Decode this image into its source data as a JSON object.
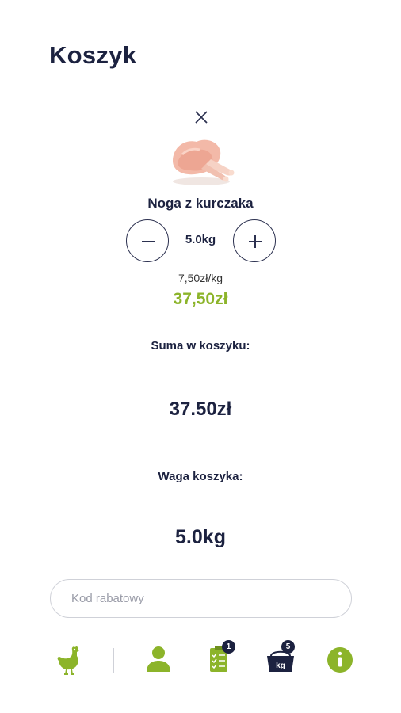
{
  "header": {
    "title": "Koszyk"
  },
  "cart_item": {
    "name": "Noga z kurczaka",
    "quantity": "5.0kg",
    "unit_price": "7,50zł/kg",
    "total": "37,50zł",
    "image": "chicken-leg"
  },
  "summary": {
    "sum_label": "Suma w koszyku:",
    "sum_value": "37.50zł",
    "weight_label": "Waga koszyka:",
    "weight_value": "5.0kg"
  },
  "coupon": {
    "placeholder": "Kod rabatowy"
  },
  "bottom_nav": {
    "items": [
      {
        "icon": "chicken-icon"
      },
      {
        "icon": "user-icon"
      },
      {
        "icon": "clipboard-icon",
        "badge": "1"
      },
      {
        "icon": "basket-kg-icon",
        "badge": "5",
        "label": "kg"
      },
      {
        "icon": "info-icon"
      }
    ]
  },
  "colors": {
    "accent": "#8cb42a",
    "text": "#1c2240",
    "border": "#cfd1d8"
  }
}
